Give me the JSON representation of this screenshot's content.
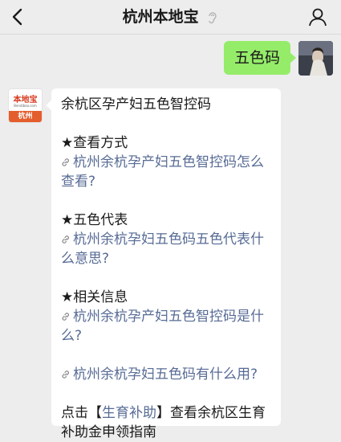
{
  "header": {
    "title": "杭州本地宝"
  },
  "user_message": {
    "text": "五色码"
  },
  "bot": {
    "logo_text": "本地宝",
    "logo_sub": "Bendibao.com",
    "logo_city": "杭州",
    "heading": "余杭区孕产妇五色智控码",
    "sections": [
      {
        "title": "★查看方式",
        "link1": "杭州余杭孕产妇五色智控码怎么",
        "link2": "查看?"
      },
      {
        "title": "★五色代表",
        "link1": "杭州余杭孕妇五色码五色代表什",
        "link2": "么意思?"
      },
      {
        "title": "★相关信息",
        "link1": "杭州余杭孕产妇五色智控码是什",
        "link2": "么?"
      }
    ],
    "extra_link": "杭州余杭孕妇五色码有什么用?",
    "footer_prefix": "点击【",
    "footer_link": "生育补助",
    "footer_suffix": "】查看余杭区生育",
    "footer_line2": "补助金申领指南"
  },
  "colors": {
    "bubble_green": "#95ec69",
    "link_blue": "#576b95",
    "bg": "#ededed"
  }
}
